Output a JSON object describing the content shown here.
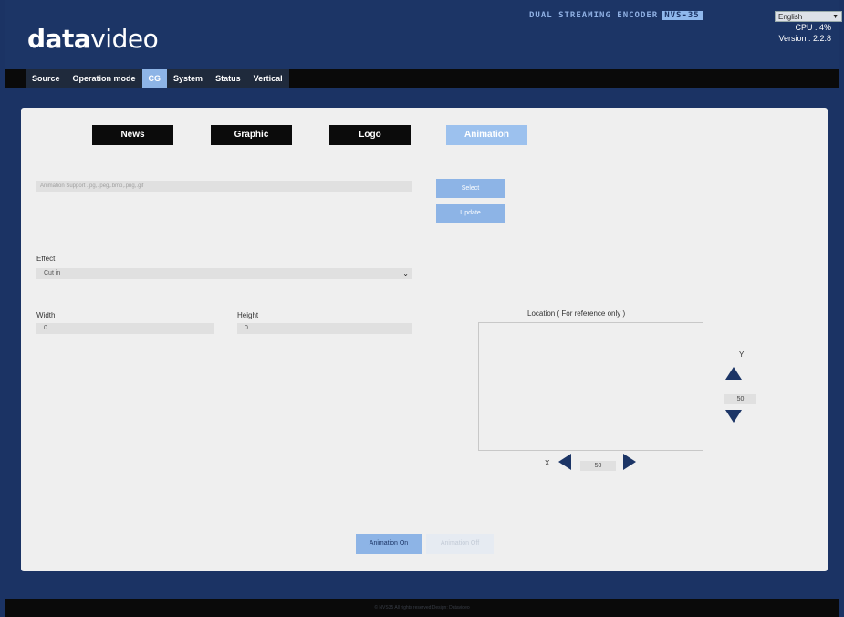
{
  "header": {
    "logo_bold": "data",
    "logo_thin": "video",
    "device_title": "DUAL STREAMING ENCODER",
    "model": "NVS-35",
    "language": "English",
    "cpu": "CPU  : 4%",
    "version": "Version : 2.2.8"
  },
  "nav": {
    "items": [
      {
        "label": "Source"
      },
      {
        "label": "Operation mode"
      },
      {
        "label": "CG"
      },
      {
        "label": "System"
      },
      {
        "label": "Status"
      },
      {
        "label": "Vertical"
      }
    ],
    "active": "CG"
  },
  "cg": {
    "types": [
      {
        "label": "News"
      },
      {
        "label": "Graphic"
      },
      {
        "label": "Logo"
      },
      {
        "label": "Animation"
      }
    ],
    "active_type": "Animation",
    "file_placeholder": "Animation Support .jpg,.jpeg,.bmp,.png,.gif",
    "select_label": "Select",
    "update_label": "Update",
    "effect_label": "Effect",
    "effect_value": "Cut in",
    "width_label": "Width",
    "width_value": "0",
    "height_label": "Height",
    "height_value": "0",
    "location_title": "Location ( For reference only )",
    "x_label": "X",
    "x_value": "50",
    "y_label": "Y",
    "y_value": "50",
    "animation_on": "Animation On",
    "animation_off": "Animation Off"
  },
  "footer": {
    "text": "© NVS35 All rights reserved Design: Datavideo"
  },
  "colors": {
    "background": "#1b3364",
    "accent": "#8db4e6",
    "dark_button": "#0b0b0b",
    "panel": "#efefef"
  }
}
